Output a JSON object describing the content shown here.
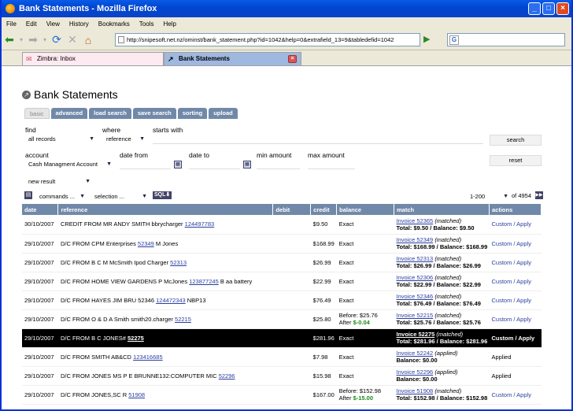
{
  "window": {
    "title": "Bank Statements - Mozilla Firefox",
    "min": "_",
    "max": "□",
    "close": "×"
  },
  "menu": [
    "File",
    "Edit",
    "View",
    "History",
    "Bookmarks",
    "Tools",
    "Help"
  ],
  "nav": {
    "url": "http://snipesoft.net.nz/ominst/bank_statement.php?id=1042&help=0&extrafield_13=9&tabledefid=1042"
  },
  "browser_tabs": [
    {
      "label": "Zimbra: Inbox",
      "active": false
    },
    {
      "label": "Bank Statements",
      "active": true
    }
  ],
  "page": {
    "title": "Bank Statements",
    "tabs": [
      "basic",
      "advanced",
      "load search",
      "save search",
      "sorting",
      "upload"
    ],
    "find_label": "find",
    "find_value": "all records",
    "where_label": "where",
    "where_value": "reference",
    "starts_with_label": "starts with",
    "search_button": "search",
    "reset_button": "reset",
    "account_label": "account",
    "account_value": "Cash Managment Account",
    "date_from_label": "date from",
    "date_to_label": "date to",
    "min_amount_label": "min amount",
    "max_amount_label": "max amount",
    "result_value": "new result",
    "commands_value": "commands ...",
    "selection_value": "selection ...",
    "sql_label": "SQL",
    "range_value": "1-200",
    "of_total": "of 4954"
  },
  "table": {
    "headers": [
      "date",
      "reference",
      "debit",
      "credit",
      "balance",
      "match",
      "actions"
    ],
    "rows": [
      {
        "date": "30/10/2007",
        "ref": "CREDIT FROM MR ANDY SMITH bbrycharger",
        "ref_link": "124497783",
        "ref_tail": "",
        "credit": "$9.50",
        "balance": "Exact",
        "balance2": "",
        "invoice": "Invoice 52365",
        "inv_status": "(matched)",
        "match_line2": "Total: $9.50 / Balance: $9.50",
        "actions": "Custom / Apply"
      },
      {
        "date": "29/10/2007",
        "ref": "D/C FROM CPM Enterprises",
        "ref_link": "52349",
        "ref_tail": "M Jones",
        "credit": "$168.99",
        "balance": "Exact",
        "balance2": "",
        "invoice": "Invoice 52349",
        "inv_status": "(matched)",
        "match_line2": "Total: $168.99 / Balance: $168.99",
        "actions": "Custom / Apply"
      },
      {
        "date": "29/10/2007",
        "ref": "D/C FROM B C M McSmith Ipod Charger",
        "ref_link": "52313",
        "ref_tail": "",
        "credit": "$26.99",
        "balance": "Exact",
        "balance2": "",
        "invoice": "Invoice 52313",
        "inv_status": "(matched)",
        "match_line2": "Total: $26.99 / Balance: $26.99",
        "actions": "Custom / Apply"
      },
      {
        "date": "29/10/2007",
        "ref": "D/C FROM HOME VIEW GARDENS P McJones",
        "ref_link": "123877245",
        "ref_tail": "B aa battery",
        "credit": "$22.99",
        "balance": "Exact",
        "balance2": "",
        "invoice": "Invoice 52306",
        "inv_status": "(matched)",
        "match_line2": "Total: $22.99 / Balance: $22.99",
        "actions": "Custom / Apply"
      },
      {
        "date": "29/10/2007",
        "ref": "D/C FROM HAYES JIM BRU 52346",
        "ref_link": "124472343",
        "ref_tail": "NBP13",
        "credit": "$76.49",
        "balance": "Exact",
        "balance2": "",
        "invoice": "Invoice 52346",
        "inv_status": "(matched)",
        "match_line2": "Total: $76.49 / Balance: $76.49",
        "actions": "Custom / Apply"
      },
      {
        "date": "29/10/2007",
        "ref": "D/C FROM O & D A Smith smith20.charger",
        "ref_link": "52215",
        "ref_tail": "",
        "credit": "$25.80",
        "balance": "Before: $25.76",
        "balance2": "After   $-0.04",
        "invoice": "Invoice 52215",
        "inv_status": "(matched)",
        "match_line2": "Total: $25.76 / Balance: $25.76",
        "actions": "Custom / Apply"
      },
      {
        "date": "29/10/2007",
        "ref": "D/C FROM B C JONES#",
        "ref_link": "52275",
        "ref_tail": "",
        "credit": "$281.96",
        "balance": "Exact",
        "balance2": "",
        "invoice": "Invoice 52275",
        "inv_status": "(matched)",
        "match_line2": "Total: $281.96 / Balance: $281.96",
        "actions": "Custom / Apply",
        "highlight": true
      },
      {
        "date": "29/10/2007",
        "ref": "D/C FROM SMITH AB&CD",
        "ref_link": "123416685",
        "ref_tail": "",
        "credit": "$7.98",
        "balance": "Exact",
        "balance2": "",
        "invoice": "Invoice 52242",
        "inv_status": "(applied)",
        "match_line2": "Balance: $0.00",
        "actions": "Applied"
      },
      {
        "date": "29/10/2007",
        "ref": "D/C FROM JONES MS P E BRUNNE132:COMPUTER MIC",
        "ref_link": "52296",
        "ref_tail": "",
        "credit": "$15.98",
        "balance": "Exact",
        "balance2": "",
        "invoice": "Invoice 52296",
        "inv_status": "(applied)",
        "match_line2": "Balance: $0.00",
        "actions": "Applied"
      },
      {
        "date": "29/10/2007",
        "ref": "D/C FROM JONES,SC R",
        "ref_link": "51908",
        "ref_tail": "",
        "credit": "$167.00",
        "balance": "Before: $152.98",
        "balance2": "After   $-15.00",
        "invoice": "Invoice 51908",
        "inv_status": "(matched)",
        "match_line2": "Total: $152.98 / Balance: $152.98",
        "actions": "Custom / Apply"
      }
    ]
  },
  "colors": {
    "header_bg": "#7189a9",
    "titlebar": "#0a5ce8",
    "link": "#2a3f9f",
    "highlight_row": "#000000"
  }
}
